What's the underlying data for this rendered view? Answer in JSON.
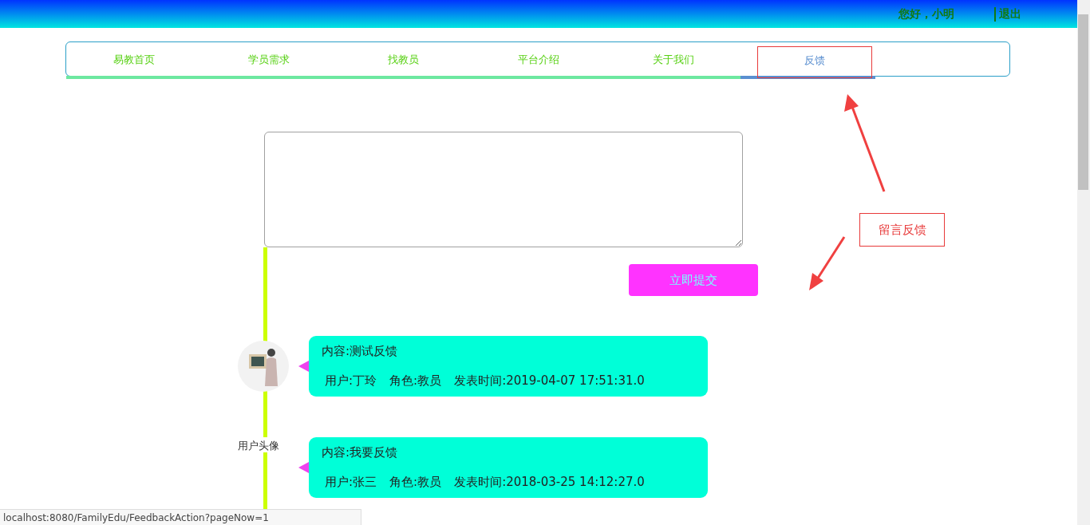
{
  "header": {
    "greeting": "您好，小明",
    "logout": "退出"
  },
  "nav": [
    {
      "label": "易教首页",
      "selected": false
    },
    {
      "label": "学员需求",
      "selected": false
    },
    {
      "label": "找教员",
      "selected": false
    },
    {
      "label": "平台介绍",
      "selected": false
    },
    {
      "label": "关于我们",
      "selected": false
    },
    {
      "label": "反馈",
      "selected": true
    }
  ],
  "feedback_form": {
    "submit": "立即提交"
  },
  "annotation": {
    "label": "留言反馈"
  },
  "feedback": [
    {
      "avatar": {
        "kind": "photo"
      },
      "content": "内容:测试反馈",
      "user": "用户:丁玲",
      "role": "角色:教员",
      "time": "发表时间:2019-04-07 17:51:31.0"
    },
    {
      "avatar": {
        "kind": "broken",
        "alt": "用户头像"
      },
      "content": "内容:我要反馈",
      "user": "用户:张三",
      "role": "角色:教员",
      "time": "发表时间:2018-03-25 14:12:27.0"
    }
  ],
  "status_bar": "localhost:8080/FamilyEdu/FeedbackAction?pageNow=1"
}
